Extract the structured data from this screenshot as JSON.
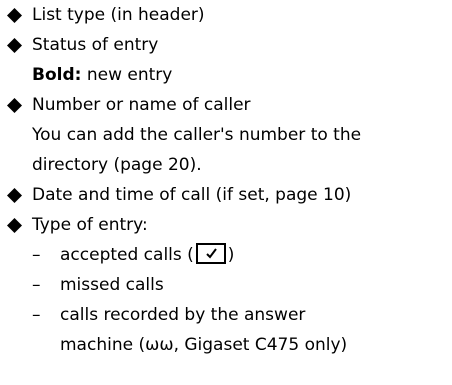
{
  "items": [
    {
      "text": "List type (in header)"
    },
    {
      "text": "Status of entry",
      "detail_bold": "Bold:",
      "detail_rest": " new entry"
    },
    {
      "text": "Number or name of caller",
      "detail_line1": "You can add the caller's number to the",
      "detail_line2": "directory (page 20)."
    },
    {
      "text": "Date and time of call (if set, page 10)"
    },
    {
      "text": "Type of entry:",
      "subitems": [
        {
          "prefix": "accepted calls (",
          "suffix": ")",
          "icon": "checkmark-box-icon"
        },
        {
          "text": "missed calls"
        },
        {
          "line1": "calls recorded by the answer",
          "line2": "machine (ωω, Gigaset C475 only)"
        }
      ]
    }
  ],
  "dash_symbol": "–",
  "bullet_icon": "diamond-bullet-icon"
}
